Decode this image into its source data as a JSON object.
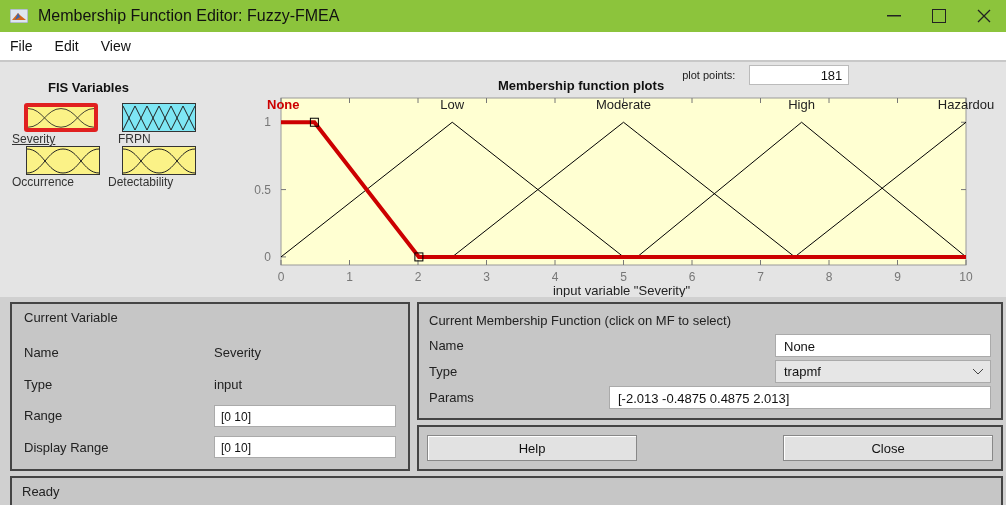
{
  "window": {
    "title": "Membership Function Editor: Fuzzy-FMEA"
  },
  "menu": [
    "File",
    "Edit",
    "View"
  ],
  "fis_variables": {
    "title": "FIS Variables",
    "items": [
      {
        "label": "Severity",
        "kind": "input",
        "selected": true
      },
      {
        "label": "FRPN",
        "kind": "output",
        "selected": false
      },
      {
        "label": "Occurrence",
        "kind": "input",
        "selected": false
      },
      {
        "label": "Detectability",
        "kind": "input",
        "selected": false
      }
    ]
  },
  "plot": {
    "plot_points_label": "plot points:",
    "plot_points": "181",
    "chart_data": {
      "type": "line",
      "title": "Membership function plots",
      "xlabel": "input variable \"Severity\"",
      "x": [
        0,
        0.4875,
        2.013,
        2.5,
        5,
        5.2,
        7.5,
        7.6,
        10
      ],
      "series": [
        {
          "name": "None",
          "color": "#cc0000",
          "values": [
            1,
            1,
            0,
            0,
            0,
            0,
            0,
            0,
            0
          ]
        },
        {
          "name": "Low",
          "color": "#000000",
          "values": [
            0,
            0.195,
            0.805,
            1,
            0,
            null,
            null,
            null,
            null
          ]
        },
        {
          "name": "Moderate",
          "color": "#000000",
          "values": [
            null,
            null,
            null,
            0,
            1,
            0.92,
            0,
            null,
            null
          ]
        },
        {
          "name": "High",
          "color": "#000000",
          "values": [
            null,
            null,
            null,
            null,
            null,
            0,
            0.958,
            1,
            0
          ]
        },
        {
          "name": "Hazardou",
          "color": "#000000",
          "values": [
            null,
            null,
            null,
            null,
            null,
            null,
            0,
            0.04,
            1
          ]
        }
      ],
      "xlim": [
        0,
        10
      ],
      "ylim": [
        -0.06,
        1.18
      ],
      "xticks": [
        0,
        1,
        2,
        3,
        4,
        5,
        6,
        7,
        8,
        9,
        10
      ],
      "yticks": [
        0,
        0.5,
        1
      ]
    },
    "mf_states": [
      {
        "selected": true
      },
      {
        "selected": false
      },
      {
        "selected": false
      },
      {
        "selected": false
      },
      {
        "selected": false
      }
    ]
  },
  "current_variable": {
    "title": "Current Variable",
    "rows": [
      {
        "label": "Name",
        "value": "Severity",
        "kind": "text"
      },
      {
        "label": "Type",
        "value": "input",
        "kind": "text"
      },
      {
        "label": "Range",
        "value": "[0 10]",
        "kind": "field"
      },
      {
        "label": "Display Range",
        "value": "[0 10]",
        "kind": "field"
      }
    ]
  },
  "current_mf": {
    "title": "Current Membership Function (click on MF to select)",
    "name_label": "Name",
    "name": "None",
    "type_label": "Type",
    "type": "trapmf",
    "params_label": "Params",
    "params": "[-2.013 -0.4875 0.4875 2.013]"
  },
  "buttons": [
    "Help",
    "Close"
  ],
  "status_bar": "Ready"
}
